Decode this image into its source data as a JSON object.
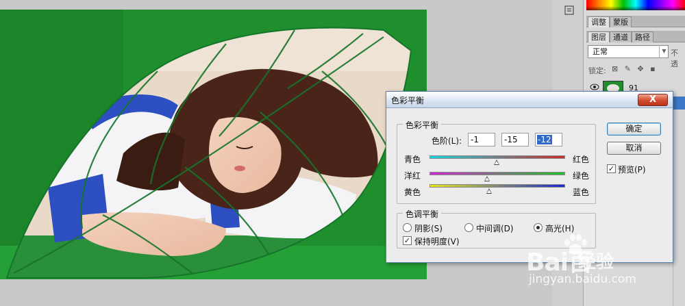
{
  "colors": {
    "canvas_green": "#1f8f2e",
    "dialog_bg": "#ececec",
    "selection": "#3169c6",
    "close_red": "#c7432a"
  },
  "panels": {
    "tabs_row1": [
      "调整",
      "蒙版"
    ],
    "tabs_row2": [
      "图层",
      "通道",
      "路径"
    ],
    "blend_mode": "正常",
    "opacity_label": "不透",
    "lock_label": "锁定:",
    "lock_icons": "⊠ ✎ ✥ ▪",
    "layer_name": "91"
  },
  "dialog": {
    "title": "色彩平衡",
    "close_label": "X",
    "color_balance_group": "色彩平衡",
    "levels_label": "色阶(L):",
    "levels": [
      "-1",
      "-15",
      "-12"
    ],
    "sliders": [
      {
        "left": "青色",
        "right": "红色",
        "value": -1
      },
      {
        "left": "洋红",
        "right": "绿色",
        "value": -15
      },
      {
        "left": "黄色",
        "right": "蓝色",
        "value": -12
      }
    ],
    "tone_group": "色调平衡",
    "tone_options": [
      "阴影(S)",
      "中间调(D)",
      "高光(H)"
    ],
    "tone_selected": 2,
    "preserve_luminosity": "保持明度(V)",
    "ok": "确定",
    "cancel": "取消",
    "preview": "预览(P)"
  },
  "watermark": {
    "brand": "Bai百",
    "jingyan": "经验",
    "url": "jingyan.baidu.com"
  }
}
